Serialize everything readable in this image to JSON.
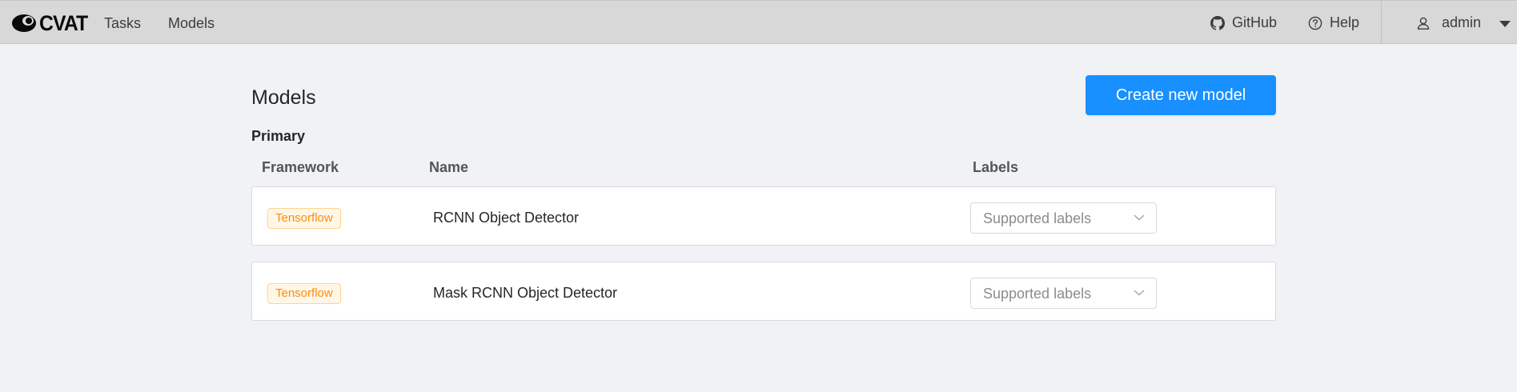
{
  "header": {
    "logo_text": "CVAT",
    "nav": [
      {
        "label": "Tasks"
      },
      {
        "label": "Models"
      }
    ],
    "github_label": "GitHub",
    "help_label": "Help",
    "user_label": "admin"
  },
  "main": {
    "title": "Models",
    "create_button_label": "Create new model",
    "section_label": "Primary",
    "columns": {
      "framework": "Framework",
      "name": "Name",
      "labels": "Labels"
    },
    "models": [
      {
        "framework": "Tensorflow",
        "name": "RCNN Object Detector",
        "labels_placeholder": "Supported labels"
      },
      {
        "framework": "Tensorflow",
        "name": "Mask RCNN Object Detector",
        "labels_placeholder": "Supported labels"
      }
    ]
  },
  "colors": {
    "primary": "#1890ff",
    "framework_tag": "#fa8c16",
    "header_bg": "#d8d8d8",
    "page_bg": "#f0f2f5"
  },
  "icons": [
    "cvat-logo-icon",
    "github-icon",
    "help-icon",
    "user-icon",
    "caret-down-icon",
    "chevron-down-icon"
  ]
}
